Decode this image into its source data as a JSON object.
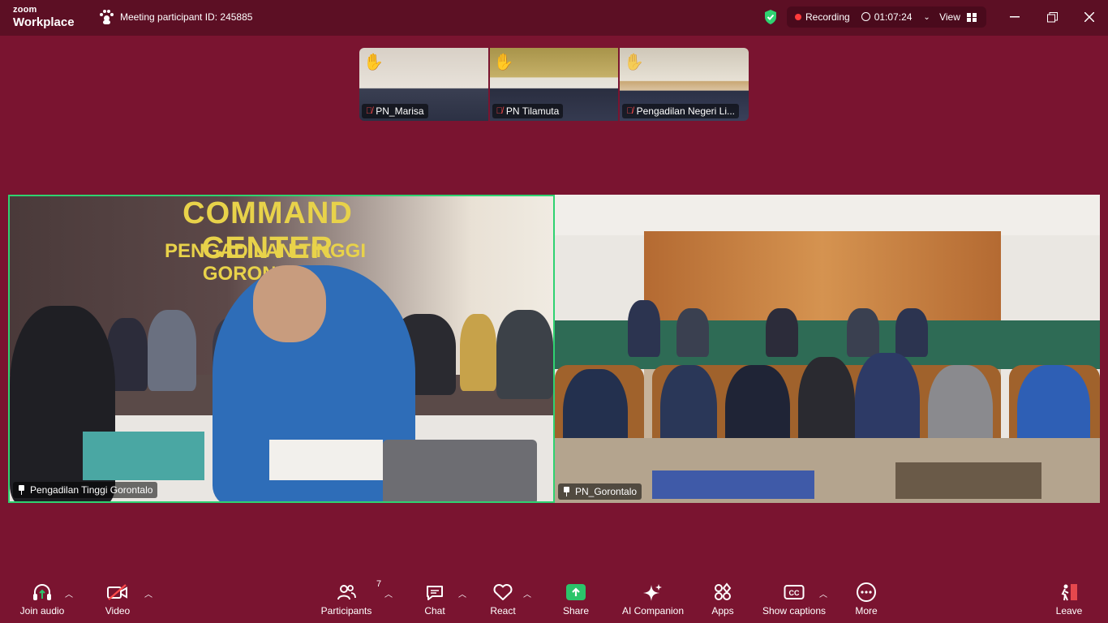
{
  "titlebar": {
    "brand_small": "zoom",
    "brand_big": "Workplace",
    "meeting_id": "Meeting participant ID: 245885",
    "recording_label": "Recording",
    "elapsed": "01:07:24",
    "view_label": "View"
  },
  "thumbnails": [
    {
      "name": "PN_Marisa",
      "hand": "✋",
      "muted": true
    },
    {
      "name": "PN Tilamuta",
      "hand": "✋",
      "muted": true
    },
    {
      "name": "Pengadilan Negeri Li...",
      "hand": "✋",
      "muted": true
    }
  ],
  "tiles": {
    "left": {
      "name": "Pengadilan Tinggi Gorontalo",
      "sign_line1": "COMMAND CENTER",
      "sign_line2": "PENGADILAN TINGGI GORONTALO",
      "active_speaker": true
    },
    "right": {
      "name": "PN_Gorontalo"
    }
  },
  "toolbar": {
    "join_audio": "Join audio",
    "video": "Video",
    "participants": "Participants",
    "participants_count": "7",
    "chat": "Chat",
    "react": "React",
    "share": "Share",
    "ai_companion": "AI Companion",
    "apps": "Apps",
    "show_captions": "Show captions",
    "more": "More",
    "leave": "Leave"
  },
  "colors": {
    "background": "#7a1430",
    "titlebar": "#5c0f24",
    "active_speaker_border": "#2fd271",
    "share_green": "#2bc46a",
    "leave_red": "#e5484d"
  }
}
